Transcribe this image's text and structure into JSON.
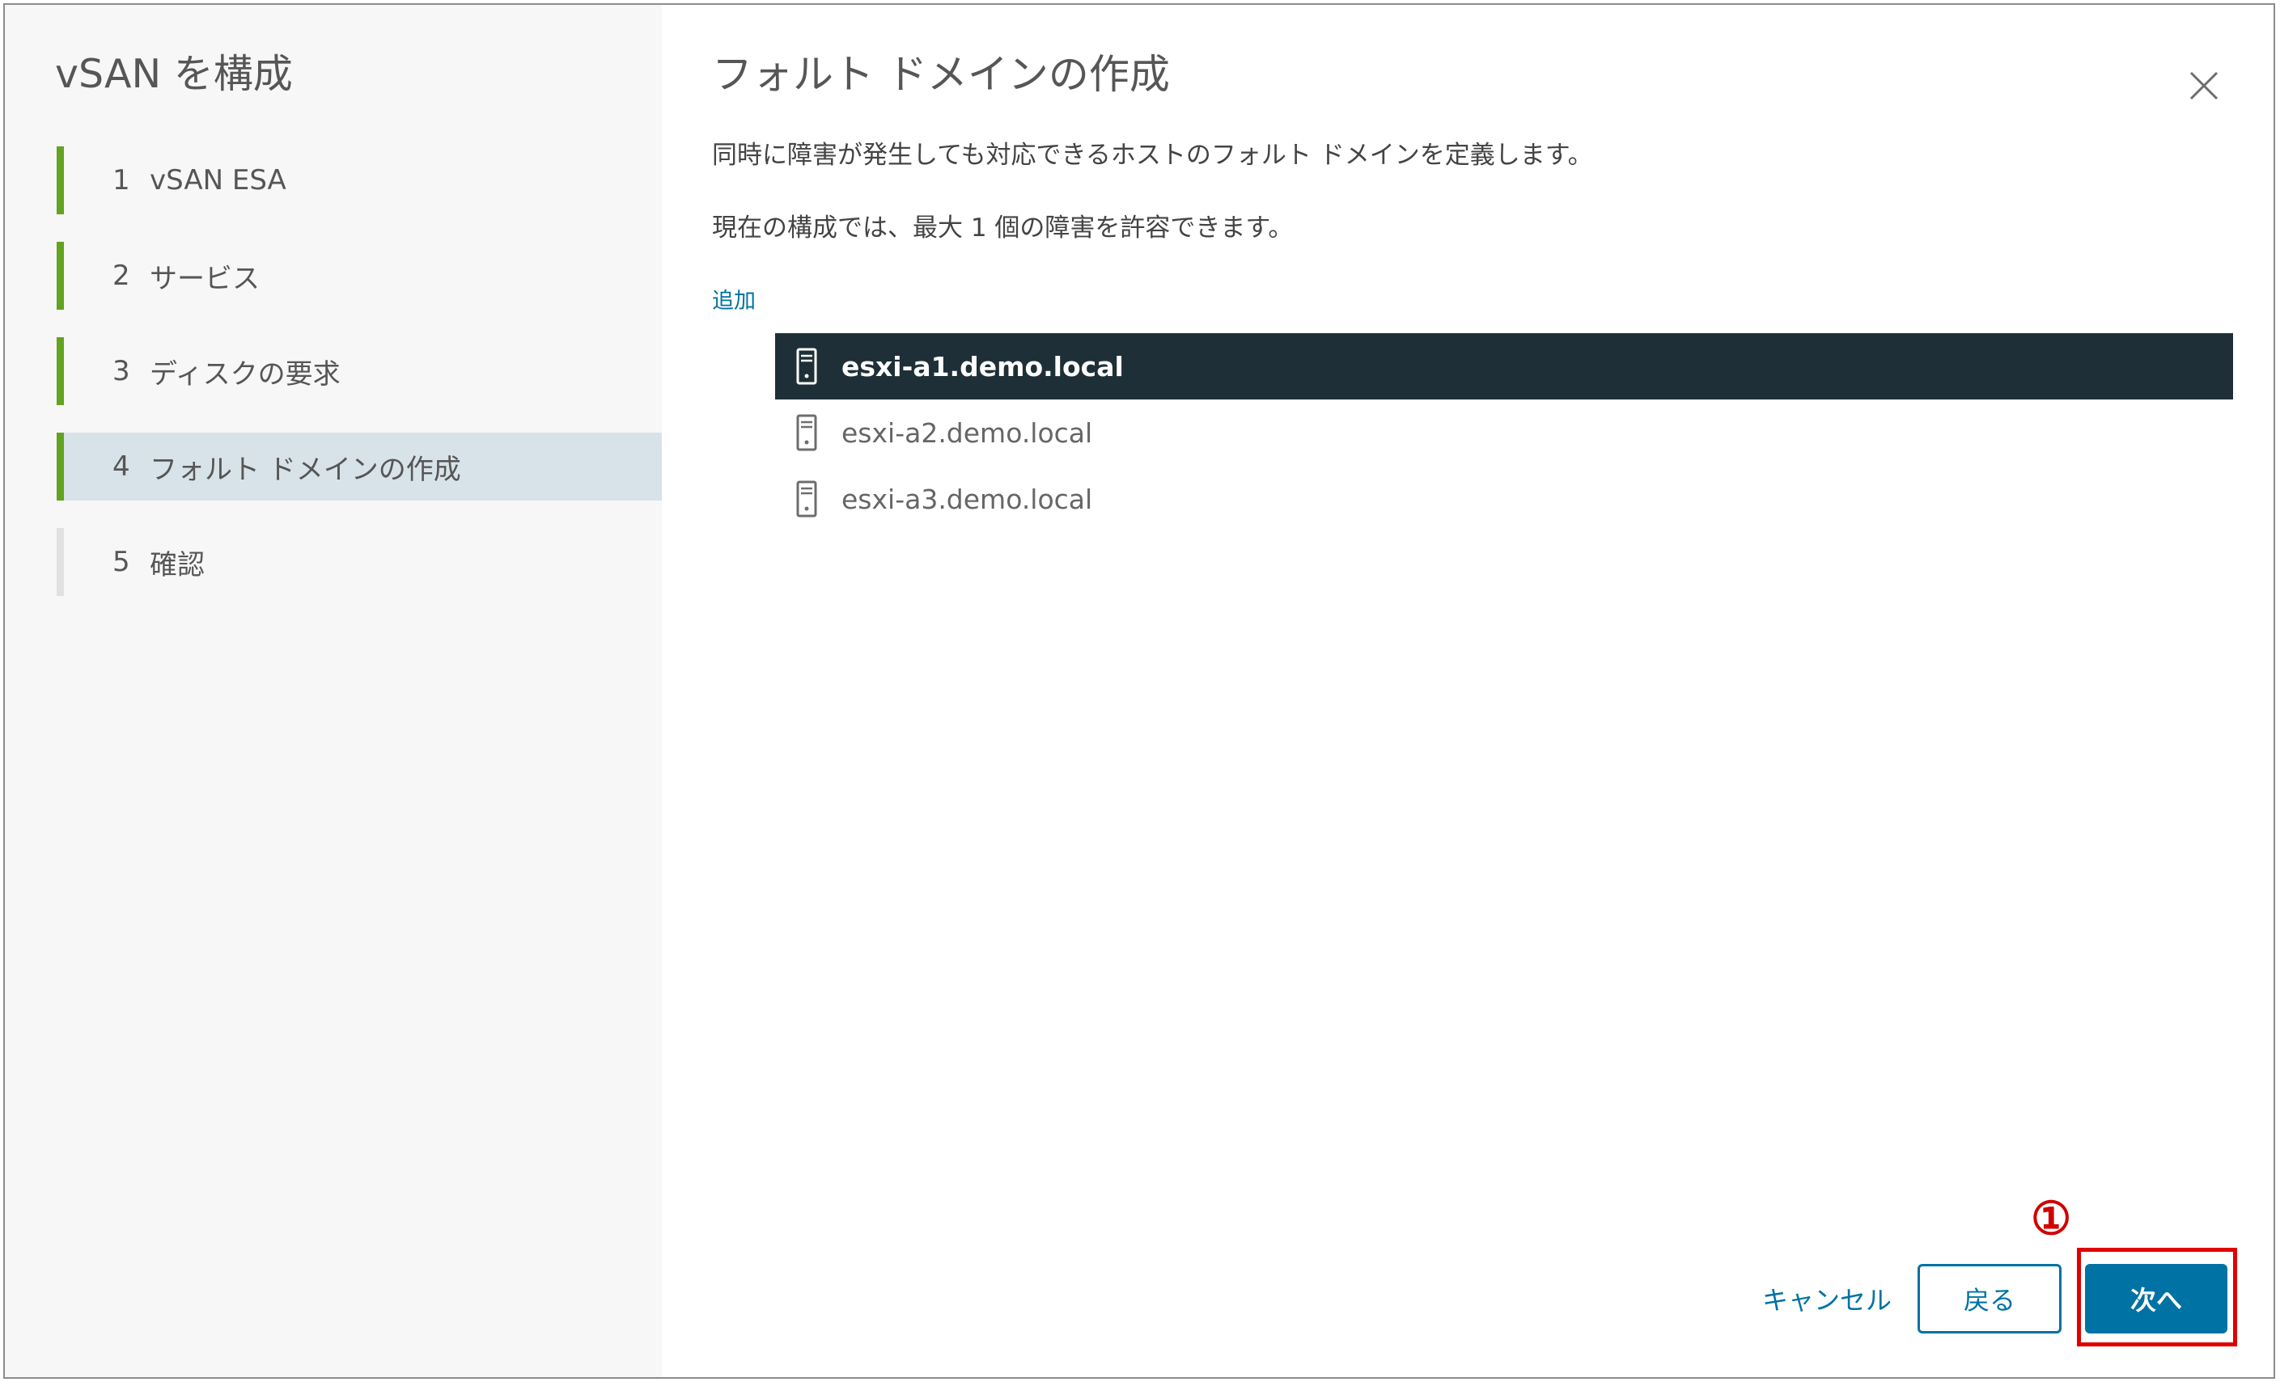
{
  "wizard": {
    "title": "vSAN を構成",
    "steps": [
      {
        "num": "1",
        "label": "vSAN ESA",
        "state": "completed"
      },
      {
        "num": "2",
        "label": "サービス",
        "state": "completed"
      },
      {
        "num": "3",
        "label": "ディスクの要求",
        "state": "completed"
      },
      {
        "num": "4",
        "label": "フォルト ドメインの作成",
        "state": "active"
      },
      {
        "num": "5",
        "label": "確認",
        "state": "pending"
      }
    ]
  },
  "page": {
    "title": "フォルト ドメインの作成",
    "description_1": "同時に障害が発生しても対応できるホストのフォルト ドメインを定義します。",
    "description_2": "現在の構成では、最大 1 個の障害を許容できます。",
    "add_link": "追加"
  },
  "hosts": [
    {
      "name": "esxi-a1.demo.local",
      "selected": true,
      "icon": "server-icon"
    },
    {
      "name": "esxi-a2.demo.local",
      "selected": false,
      "icon": "server-icon"
    },
    {
      "name": "esxi-a3.demo.local",
      "selected": false,
      "icon": "server-icon"
    }
  ],
  "footer": {
    "cancel_label": "キャンセル",
    "back_label": "戻る",
    "next_label": "次へ"
  },
  "annotation": {
    "marker": "①",
    "color": "#e00000"
  },
  "colors": {
    "primary": "#0072a3",
    "progress": "#62a420",
    "selected_row": "#1f2f38",
    "active_step": "#d8e3e9"
  }
}
